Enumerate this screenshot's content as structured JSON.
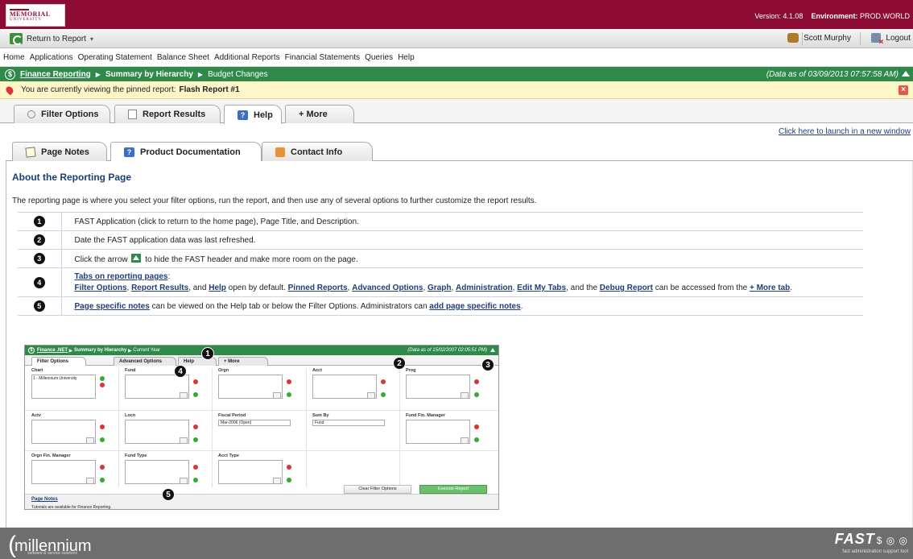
{
  "header": {
    "logo_line1": "MEMORIAL",
    "logo_line2": "UNIVERSITY",
    "version_label": "Version:",
    "version": "4.1.08",
    "env_label": "Environment:",
    "env": "PROD.WORLD"
  },
  "toolbar": {
    "return_label": "Return to Report",
    "return_caret": "▾",
    "user": "Scott Murphy",
    "logout": "Logout"
  },
  "menu": [
    "Home",
    "Applications",
    "Operating Statement",
    "Balance Sheet",
    "Additional Reports",
    "Financial Statements",
    "Queries",
    "Help"
  ],
  "breadcrumb": {
    "app": "Finance Reporting",
    "page": "Summary by Hierarchy",
    "desc": "Budget Changes",
    "as_of": "(Data as of 03/09/2013 07:57:58 AM)"
  },
  "pinned": {
    "text": "You are currently viewing the pinned report:",
    "name": "Flash Report #1"
  },
  "main_tabs": [
    "Filter Options",
    "Report Results",
    "Help",
    "+ More"
  ],
  "launch_link": "Click here to launch in a new window",
  "help_tabs": [
    "Page Notes",
    "Product Documentation",
    "Contact Info"
  ],
  "content": {
    "title": "About the Reporting Page",
    "intro": "The reporting page is where you select your filter options, run the report, and then use any of several options to further customize the report results.",
    "steps": {
      "s1": "FAST Application (click to return to the home page), Page Title, and Description.",
      "s2": "Date the FAST application data was last refreshed.",
      "s3a": "Click the arrow",
      "s3b": "to hide the FAST header and make more room on the page.",
      "s4_title": "Tabs on reporting pages",
      "s4_colon": ":",
      "s4_l1": "Filter Options",
      "s4_l2": "Report Results",
      "s4_and1": ", and",
      "s4_l3": "Help",
      "s4_mid": "open by default.",
      "s4_l4": "Pinned Reports",
      "s4_l5": "Advanced Options",
      "s4_l6": "Graph",
      "s4_l7": "Administration",
      "s4_l8": "Edit My Tabs",
      "s4_and2": ", and the",
      "s4_l9": "Debug Report",
      "s4_end": "can be accessed from the",
      "s4_l10": "+ More tab",
      "s5_l1": "Page specific notes",
      "s5_mid": "can be viewed on the Help tab or below the Filter Options. Administrators can",
      "s5_l2": "add page specific notes",
      "comma": ",",
      "period": "."
    },
    "nums": [
      "1",
      "2",
      "3",
      "4",
      "5"
    ]
  },
  "screenshot": {
    "app": "Finance .NET",
    "page": "Summary by Hierarchy",
    "desc": "Current Year",
    "as_of": "(Data as of 15/02/2007 02:05:51 PM)",
    "tabs": [
      "Filter Options",
      "Advanced Options",
      "Help",
      "+ More"
    ],
    "fields": {
      "chart": "Chart",
      "chart_val": "1 - Millennium University",
      "fund": "Fund",
      "orgn": "Orgn",
      "acct": "Acct",
      "prog": "Prog",
      "actv": "Actv",
      "locn": "Locn",
      "fiscal": "Fiscal Period",
      "fiscal_val": "Mar-2006 (Open)",
      "sumby": "Sum By",
      "sumby_val": "Fund",
      "ffm": "Fund Fin. Manager",
      "ofm": "Orgn Fin. Manager",
      "ftype": "Fund Type",
      "atype": "Acct Type"
    },
    "clear_btn": "Clear Filter Options",
    "exec_btn": "Execute Report",
    "page_notes": "Page Notes",
    "tutorial": "Tutorials are available for Finance Reporting."
  },
  "footer": {
    "brand": "millennium",
    "brand_sub": "software & service solutions",
    "fast": "FAST",
    "fast_sub": "fast administration support tool"
  },
  "colors": {
    "banner": "#8c0c34",
    "green": "#2f8a4a",
    "pinned": "#fdf6c8",
    "footer": "#6e6e6e"
  }
}
